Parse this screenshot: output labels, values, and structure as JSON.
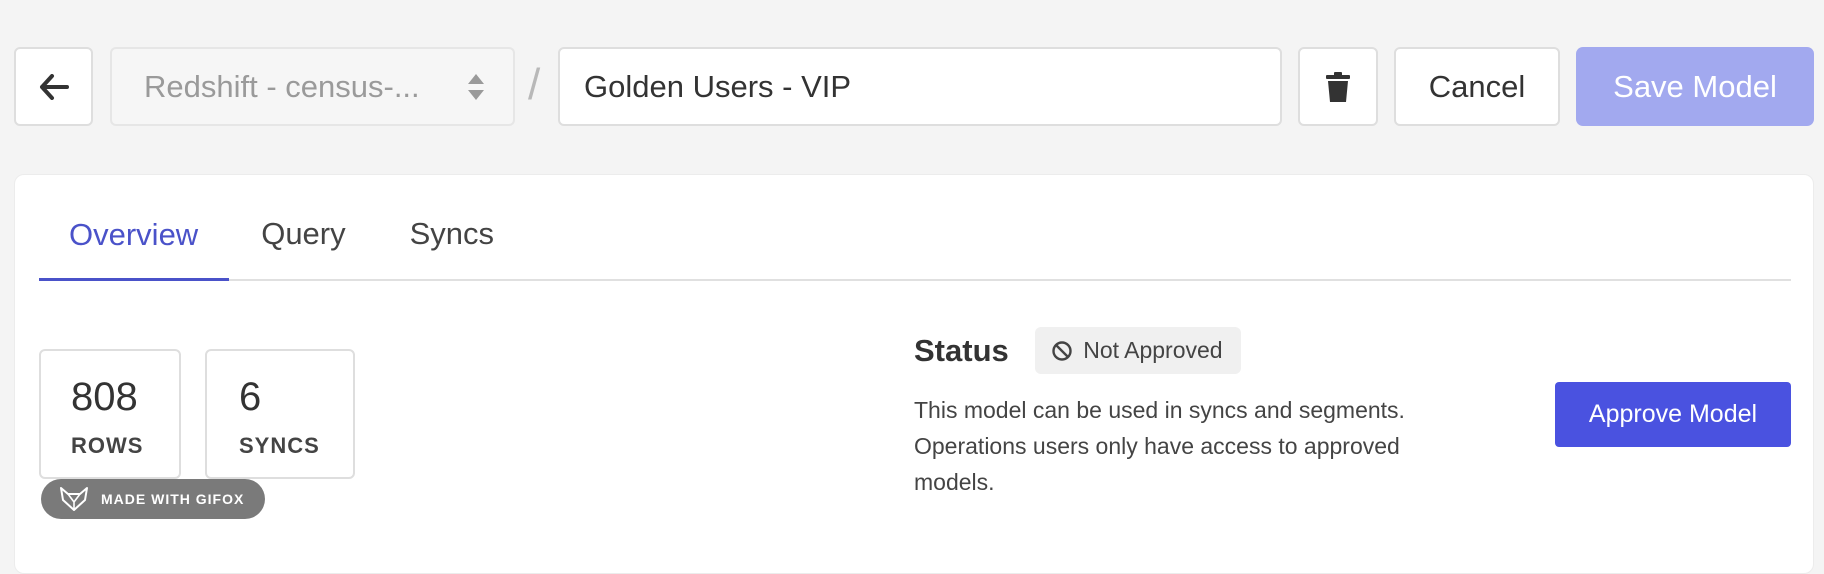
{
  "header": {
    "source_value": "Redshift - census-...",
    "separator": "/",
    "model_name": "Golden Users - VIP",
    "cancel_label": "Cancel",
    "save_label": "Save Model"
  },
  "tabs": [
    {
      "label": "Overview",
      "active": true
    },
    {
      "label": "Query",
      "active": false
    },
    {
      "label": "Syncs",
      "active": false
    }
  ],
  "stats": [
    {
      "value": "808",
      "label": "ROWS"
    },
    {
      "value": "6",
      "label": "SYNCS"
    }
  ],
  "status": {
    "title": "Status",
    "badge": "Not Approved",
    "description": "This model can be used in syncs and segments. Operations users only have access to approved models."
  },
  "approve_label": "Approve Model",
  "watermark": "MADE WITH GIFOX",
  "colors": {
    "accent": "#4a52e0",
    "accent_disabled": "#a2a9ef",
    "active_tab": "#4a52c9"
  },
  "icons": [
    "arrow-left-icon",
    "sort-icon",
    "trash-icon",
    "ban-icon",
    "gifox-logo-icon"
  ]
}
